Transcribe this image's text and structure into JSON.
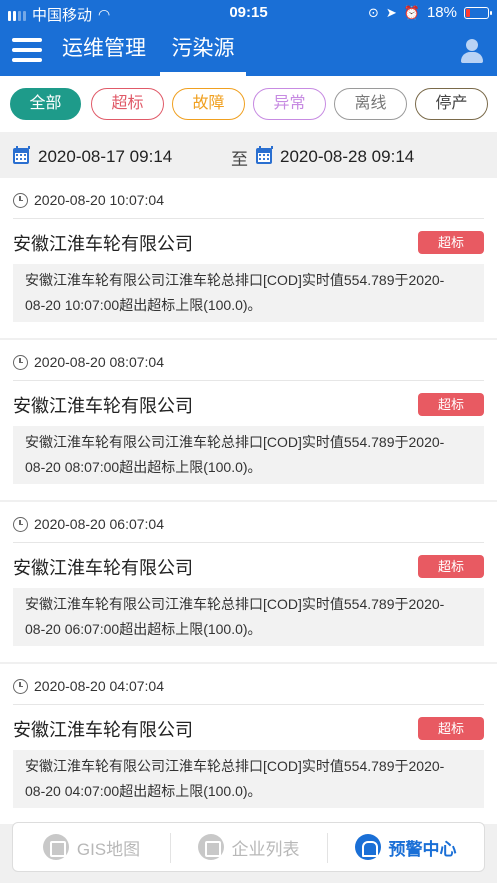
{
  "status_bar": {
    "carrier": "中国移动",
    "time": "09:15",
    "battery": "18%"
  },
  "header": {
    "tabs": [
      "运维管理",
      "污染源"
    ],
    "active_tab": "污染源"
  },
  "filters": [
    "全部",
    "超标",
    "故障",
    "异常",
    "离线",
    "停产"
  ],
  "active_filter": "全部",
  "date_range": {
    "start": "2020-08-17 09:14",
    "separator": "至",
    "end": "2020-08-28 09:14"
  },
  "records": [
    {
      "time": "2020-08-20 10:07:04",
      "company": "安徽江淮车轮有限公司",
      "badge": "超标",
      "msg_line1": "安徽江淮车轮有限公司江淮车轮总排口[COD]实时值554.789于2020-",
      "msg_line2": "08-20 10:07:00超出超标上限(100.0)。"
    },
    {
      "time": "2020-08-20 08:07:04",
      "company": "安徽江淮车轮有限公司",
      "badge": "超标",
      "msg_line1": "安徽江淮车轮有限公司江淮车轮总排口[COD]实时值554.789于2020-",
      "msg_line2": "08-20 08:07:00超出超标上限(100.0)。"
    },
    {
      "time": "2020-08-20 06:07:04",
      "company": "安徽江淮车轮有限公司",
      "badge": "超标",
      "msg_line1": "安徽江淮车轮有限公司江淮车轮总排口[COD]实时值554.789于2020-",
      "msg_line2": "08-20 06:07:00超出超标上限(100.0)。"
    },
    {
      "time": "2020-08-20 04:07:04",
      "company": "安徽江淮车轮有限公司",
      "badge": "超标",
      "msg_line1": "安徽江淮车轮有限公司江淮车轮总排口[COD]实时值554.789于2020-",
      "msg_line2": "08-20 04:07:00超出超标上限(100.0)。"
    }
  ],
  "bottom_nav": [
    "GIS地图",
    "企业列表",
    "预警中心"
  ],
  "active_nav": "预警中心",
  "colors": {
    "primary": "#1a6fd6",
    "badge": "#e85a62",
    "active_chip": "#1e9b8a"
  }
}
